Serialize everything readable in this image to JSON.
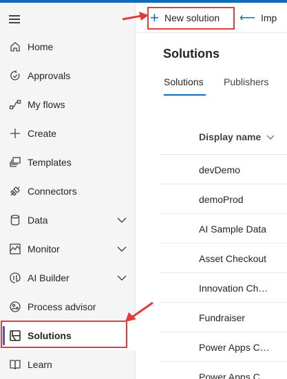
{
  "sidebar": {
    "items": [
      {
        "label": "Home",
        "icon": "home-icon"
      },
      {
        "label": "Approvals",
        "icon": "approvals-icon"
      },
      {
        "label": "My flows",
        "icon": "flows-icon"
      },
      {
        "label": "Create",
        "icon": "plus-icon"
      },
      {
        "label": "Templates",
        "icon": "templates-icon"
      },
      {
        "label": "Connectors",
        "icon": "connectors-icon"
      },
      {
        "label": "Data",
        "icon": "database-icon",
        "expandable": true
      },
      {
        "label": "Monitor",
        "icon": "monitor-icon",
        "expandable": true
      },
      {
        "label": "AI Builder",
        "icon": "ai-builder-icon",
        "expandable": true
      },
      {
        "label": "Process advisor",
        "icon": "process-advisor-icon"
      },
      {
        "label": "Solutions",
        "icon": "solutions-icon",
        "active": true
      },
      {
        "label": "Learn",
        "icon": "learn-icon"
      }
    ]
  },
  "command_bar": {
    "new_solution": "New solution",
    "import": "Imp"
  },
  "page": {
    "title": "Solutions",
    "tabs": [
      {
        "label": "Solutions",
        "selected": true
      },
      {
        "label": "Publishers",
        "selected": false
      }
    ]
  },
  "table": {
    "column_header": "Display name",
    "rows": [
      "devDemo",
      "demoProd",
      "AI Sample Data",
      "Asset Checkout",
      "Innovation Ch…",
      "Fundraiser",
      "Power Apps C…",
      "Power Apps C…"
    ]
  },
  "colors": {
    "accent": "#0f6cbd",
    "active_indicator": "#4f52b2",
    "annotation": "#e23b3b",
    "sidebar_bg": "#f5f5f5"
  }
}
